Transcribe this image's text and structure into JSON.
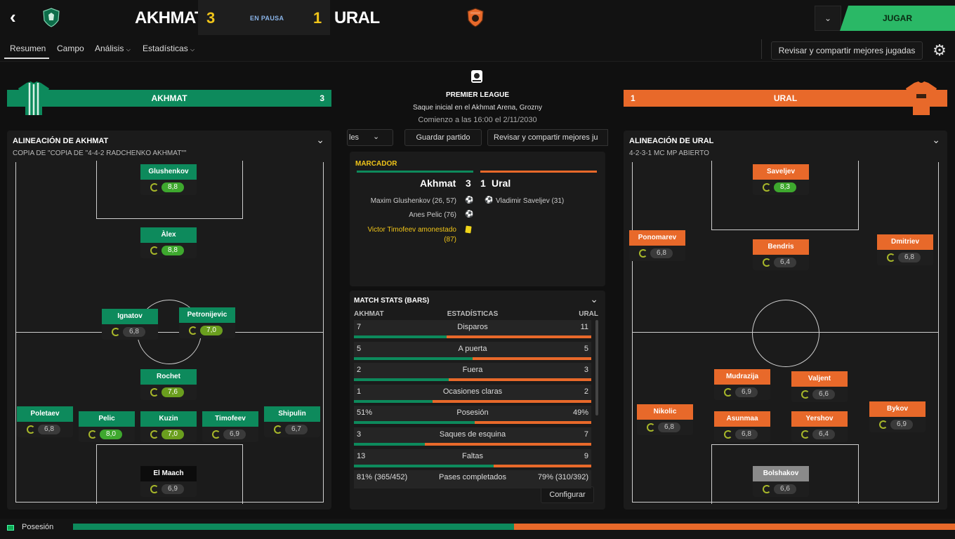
{
  "header": {
    "home_team": "AKHMAT",
    "home_score": "3",
    "status": "EN PAUSA",
    "away_score": "1",
    "away_team": "URAL",
    "play_label": "JUGAR",
    "dropdown_icon": "chevron-down-icon"
  },
  "tabs": [
    "Resumen",
    "Campo",
    "Análisis",
    "Estadísticas"
  ],
  "review_label": "Revisar y compartir mejores jugadas",
  "home": {
    "bar_name": "AKHMAT",
    "bar_score": "3",
    "lineup_title": "ALINEACIÓN DE AKHMAT",
    "formation": "COPIA DE \"COPIA DE \"4-4-2 RADCHENKO AKHMAT\"\"",
    "players": [
      {
        "name": "Glushenkov",
        "rating": "8,8"
      },
      {
        "name": "Àlex",
        "rating": "8,8"
      },
      {
        "name": "Ignatov",
        "rating": "6,8"
      },
      {
        "name": "Petronijevic",
        "rating": "7,0"
      },
      {
        "name": "Rochet",
        "rating": "7,6"
      },
      {
        "name": "Poletaev",
        "rating": "6,8"
      },
      {
        "name": "Pelic",
        "rating": "8,0"
      },
      {
        "name": "Kuzin",
        "rating": "7,0"
      },
      {
        "name": "Timofeev",
        "rating": "6,9"
      },
      {
        "name": "Shipulin",
        "rating": "6,7"
      },
      {
        "name": "El Maach",
        "rating": "6,9"
      }
    ]
  },
  "away": {
    "bar_name": "URAL",
    "bar_score": "1",
    "lineup_title": "ALINEACIÓN DE URAL",
    "formation": "4-2-3-1 MC MP ABIERTO",
    "players": [
      {
        "name": "Saveljev",
        "rating": "8,3"
      },
      {
        "name": "Ponomarev",
        "rating": "6,8"
      },
      {
        "name": "Bendris",
        "rating": "6,4"
      },
      {
        "name": "Dmitriev",
        "rating": "6,8"
      },
      {
        "name": "Mudrazija",
        "rating": "6,9"
      },
      {
        "name": "Valjent",
        "rating": "6,6"
      },
      {
        "name": "Nikolic",
        "rating": "6,8"
      },
      {
        "name": "Asunmaa",
        "rating": "6,8"
      },
      {
        "name": "Yershov",
        "rating": "6,4"
      },
      {
        "name": "Bykov",
        "rating": "6,9"
      },
      {
        "name": "Bolshakov",
        "rating": "6,6"
      }
    ]
  },
  "match": {
    "league": "PREMIER LEAGUE",
    "kickoff": "Saque inicial en el Akhmat Arena, Grozny",
    "start": "Comienzo a las 16:00 el 2/11/2030",
    "left_btn": "les",
    "save_btn": "Guardar partido",
    "review_btn": "Revisar y compartir mejores ju"
  },
  "scoreboard": {
    "title": "MARCADOR",
    "home": "Akhmat",
    "home_score": "3",
    "away_score": "1",
    "away": "Ural",
    "home_events": [
      "Maxim Glushenkov (26, 57)",
      "Anes Pelic (76)"
    ],
    "away_events": [
      "Vladimir Saveljev (31)"
    ],
    "booking_line1": "Victor Timofeev amonestado",
    "booking_line2": "(87)"
  },
  "stats": {
    "title": "MATCH STATS (BARS)",
    "col_home": "AKHMAT",
    "col_mid": "ESTADÍSTICAS",
    "col_away": "URAL",
    "config_label": "Configurar",
    "rows": [
      {
        "home": "7",
        "label": "Disparos",
        "away": "11",
        "home_share": 0.39
      },
      {
        "home": "5",
        "label": "A puerta",
        "away": "5",
        "home_share": 0.5
      },
      {
        "home": "2",
        "label": "Fuera",
        "away": "3",
        "home_share": 0.4
      },
      {
        "home": "1",
        "label": "Ocasiones claras",
        "away": "2",
        "home_share": 0.33
      },
      {
        "home": "51%",
        "label": "Posesión",
        "away": "49%",
        "home_share": 0.51
      },
      {
        "home": "3",
        "label": "Saques de esquina",
        "away": "7",
        "home_share": 0.3
      },
      {
        "home": "13",
        "label": "Faltas",
        "away": "9",
        "home_share": 0.59
      },
      {
        "home": "81% (365/452)",
        "label": "Pases completados",
        "away": "79% (310/392)",
        "home_share": 0.5
      }
    ]
  },
  "footer": {
    "label": "Posesión",
    "home_share": 0.51
  },
  "colors": {
    "home": "#0d8a5c",
    "away": "#e8692a",
    "accent": "#2ab866"
  }
}
